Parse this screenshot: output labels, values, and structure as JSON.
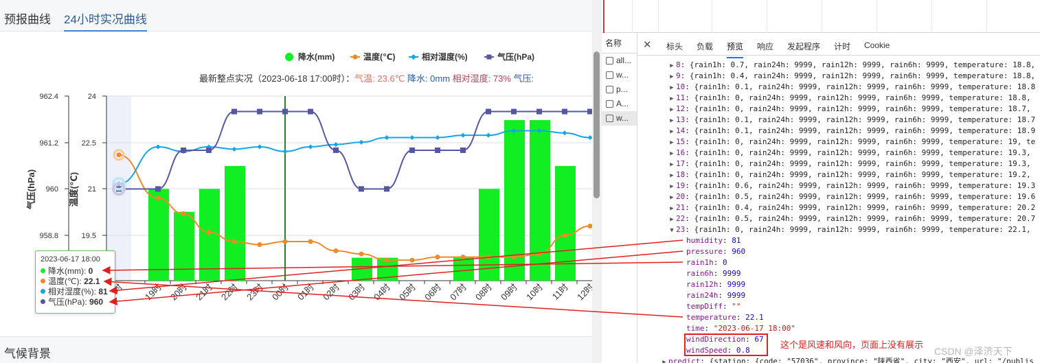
{
  "tabs": [
    "预报曲线",
    "24小时实况曲线"
  ],
  "active_tab": 1,
  "legend": [
    {
      "label": "降水(mm)",
      "color": "#11ee22",
      "shape": "circle"
    },
    {
      "label": "温度(℃)",
      "color": "#f08a24",
      "shape": "line-circle"
    },
    {
      "label": "相对湿度(%)",
      "color": "#15a5e6",
      "shape": "line-diamond"
    },
    {
      "label": "气压(hPa)",
      "color": "#5557a5",
      "shape": "line-square"
    }
  ],
  "latest": {
    "prefix": "最新整点实况（2023-06-18 17:00时）：",
    "temp_label": "气温:",
    "temp_value": "23.6℃",
    "rain_label": "降水:",
    "rain_value": "0mm",
    "hum_label": "相对湿度:",
    "hum_value": "73%",
    "pres_label": "气压:"
  },
  "axes": {
    "pressure_label": "气压(hPa)",
    "temp_label": "温度(℃)",
    "pressure_ticks": [
      "962.4",
      "961.2",
      "960",
      "958.8"
    ],
    "temp_ticks": [
      "24",
      "22.5",
      "21",
      "19.5"
    ]
  },
  "chart_data": {
    "type": "line",
    "categories": [
      "18时",
      "19时",
      "20时",
      "21时",
      "22时",
      "23时",
      "00时",
      "01时",
      "02时",
      "03时",
      "04时",
      "05时",
      "06时",
      "07时",
      "08时",
      "09时",
      "10时",
      "11时",
      "12时",
      "13时"
    ],
    "series": [
      {
        "name": "降水(mm)",
        "type": "bar",
        "color": "#11ee22",
        "values": [
          0,
          0.4,
          0.3,
          0.4,
          0.5,
          0,
          0,
          0,
          0,
          0.1,
          0.1,
          0,
          0,
          0.1,
          0.4,
          0.7,
          0.7,
          0.5,
          0,
          0.1
        ]
      },
      {
        "name": "温度(℃)",
        "type": "line",
        "color": "#f08a24",
        "values": [
          22.1,
          20.7,
          20.2,
          19.6,
          19.3,
          19.2,
          19.3,
          19.3,
          19.0,
          18.9,
          18.7,
          18.7,
          18.8,
          18.8,
          18.8,
          18.8,
          18.9,
          19.5,
          19.8,
          20.3
        ]
      },
      {
        "name": "相对湿度(%)",
        "type": "line",
        "color": "#15a5e6",
        "values": [
          81,
          89,
          88,
          89,
          88.5,
          89,
          88,
          89,
          89.5,
          90,
          91,
          91,
          91,
          91.5,
          91.5,
          92.5,
          92.5,
          92,
          91,
          89.5
        ]
      },
      {
        "name": "气压(hPa)",
        "type": "line",
        "color": "#5557a5",
        "values": [
          960,
          960,
          961,
          961,
          962,
          962,
          962,
          962,
          961,
          960,
          960,
          961,
          961,
          961,
          962,
          962,
          962,
          962,
          962,
          962
        ]
      }
    ],
    "marker_category": "00时"
  },
  "tooltip": {
    "time": "2023-06-17 18:00",
    "rows": [
      {
        "label": "降水(mm):",
        "value": "0",
        "color": "#11ee22"
      },
      {
        "label": "温度(℃):",
        "value": "22.1",
        "color": "#f08a24"
      },
      {
        "label": "相对湿度(%):",
        "value": "81",
        "color": "#15a5e6"
      },
      {
        "label": "气压(hPa):",
        "value": "960",
        "color": "#5557a5"
      }
    ]
  },
  "section2_title": "气候背景",
  "devtools": {
    "name_header": "名称",
    "files": [
      "all...",
      "w...",
      "p...",
      "A...",
      "w..."
    ],
    "tabs": [
      "标头",
      "负载",
      "预览",
      "响应",
      "发起程序",
      "计时",
      "Cookie"
    ],
    "active_tab": 2,
    "lines": [
      "8: {rain1h: 0.7, rain24h: 9999, rain12h: 9999, rain6h: 9999, temperature: 18.8,",
      "9: {rain1h: 0.4, rain24h: 9999, rain12h: 9999, rain6h: 9999, temperature: 18.8,",
      "10: {rain1h: 0.1, rain24h: 9999, rain12h: 9999, rain6h: 9999, temperature: 18.8",
      "11: {rain1h: 0, rain24h: 9999, rain12h: 9999, rain6h: 9999, temperature: 18.8,",
      "12: {rain1h: 0, rain24h: 9999, rain12h: 9999, rain6h: 9999, temperature: 18.7,",
      "13: {rain1h: 0.1, rain24h: 9999, rain12h: 9999, rain6h: 9999, temperature: 18.7",
      "14: {rain1h: 0.1, rain24h: 9999, rain12h: 9999, rain6h: 9999, temperature: 18.9",
      "15: {rain1h: 0, rain24h: 9999, rain12h: 9999, rain6h: 9999, temperature: 19, te",
      "16: {rain1h: 0, rain24h: 9999, rain12h: 9999, rain6h: 9999, temperature: 19.3,",
      "17: {rain1h: 0, rain24h: 9999, rain12h: 9999, rain6h: 9999, temperature: 19.3,",
      "18: {rain1h: 0, rain24h: 9999, rain12h: 9999, rain6h: 9999, temperature: 19.2,",
      "19: {rain1h: 0.6, rain24h: 9999, rain12h: 9999, rain6h: 9999, temperature: 19.3",
      "20: {rain1h: 0.5, rain24h: 9999, rain12h: 9999, rain6h: 9999, temperature: 19.6",
      "21: {rain1h: 0.4, rain24h: 9999, rain12h: 9999, rain6h: 9999, temperature: 20.2",
      "22: {rain1h: 0.5, rain24h: 9999, rain12h: 9999, rain6h: 9999, temperature: 20.7",
      "23: {rain1h: 0, rain24h: 9999, rain12h: 9999, rain6h: 9999, temperature: 22.1,"
    ],
    "props": [
      {
        "k": "humidity",
        "v": "81",
        "t": "n"
      },
      {
        "k": "pressure",
        "v": "960",
        "t": "n"
      },
      {
        "k": "rain1h",
        "v": "0",
        "t": "n"
      },
      {
        "k": "rain6h",
        "v": "9999",
        "t": "n"
      },
      {
        "k": "rain12h",
        "v": "9999",
        "t": "n"
      },
      {
        "k": "rain24h",
        "v": "9999",
        "t": "n"
      },
      {
        "k": "tempDiff",
        "v": "\"\"",
        "t": "s"
      },
      {
        "k": "temperature",
        "v": "22.1",
        "t": "n"
      },
      {
        "k": "time",
        "v": "\"2023-06-17 18:00\"",
        "t": "s"
      },
      {
        "k": "windDirection",
        "v": "67",
        "t": "n"
      },
      {
        "k": "windSpeed",
        "v": "0.8",
        "t": "n"
      }
    ],
    "predict_line": "predict: {station: {code: \"57036\", province: \"陕西省\", city: \"西安\", url: \"/publis"
  },
  "annotation": "这个是风速和风向，页面上没有展示",
  "watermark": "CSDN @泽济天下"
}
